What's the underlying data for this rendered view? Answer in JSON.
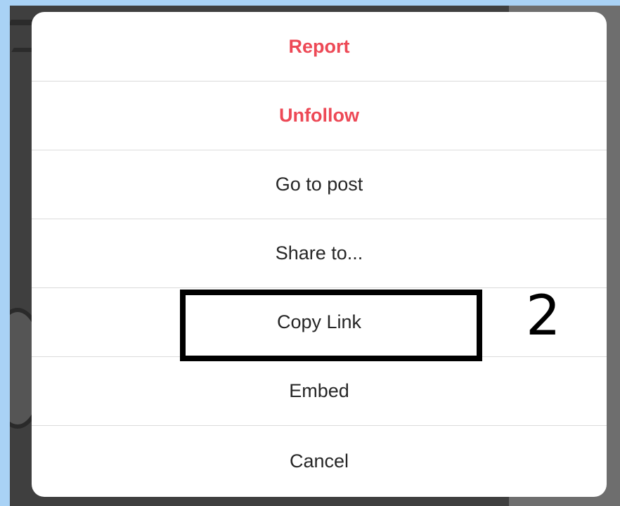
{
  "dialog": {
    "items": [
      {
        "label": "Report",
        "style": "danger"
      },
      {
        "label": "Unfollow",
        "style": "danger"
      },
      {
        "label": "Go to post",
        "style": "normal"
      },
      {
        "label": "Share to...",
        "style": "normal"
      },
      {
        "label": "Copy Link",
        "style": "normal"
      },
      {
        "label": "Embed",
        "style": "normal"
      },
      {
        "label": "Cancel",
        "style": "normal"
      }
    ]
  },
  "annotation": {
    "number": "2"
  },
  "colors": {
    "danger": "#ed4956",
    "text": "#262626",
    "divider": "#dbdbdb",
    "frame": "#a9d2f5",
    "annotation": "#000000"
  }
}
